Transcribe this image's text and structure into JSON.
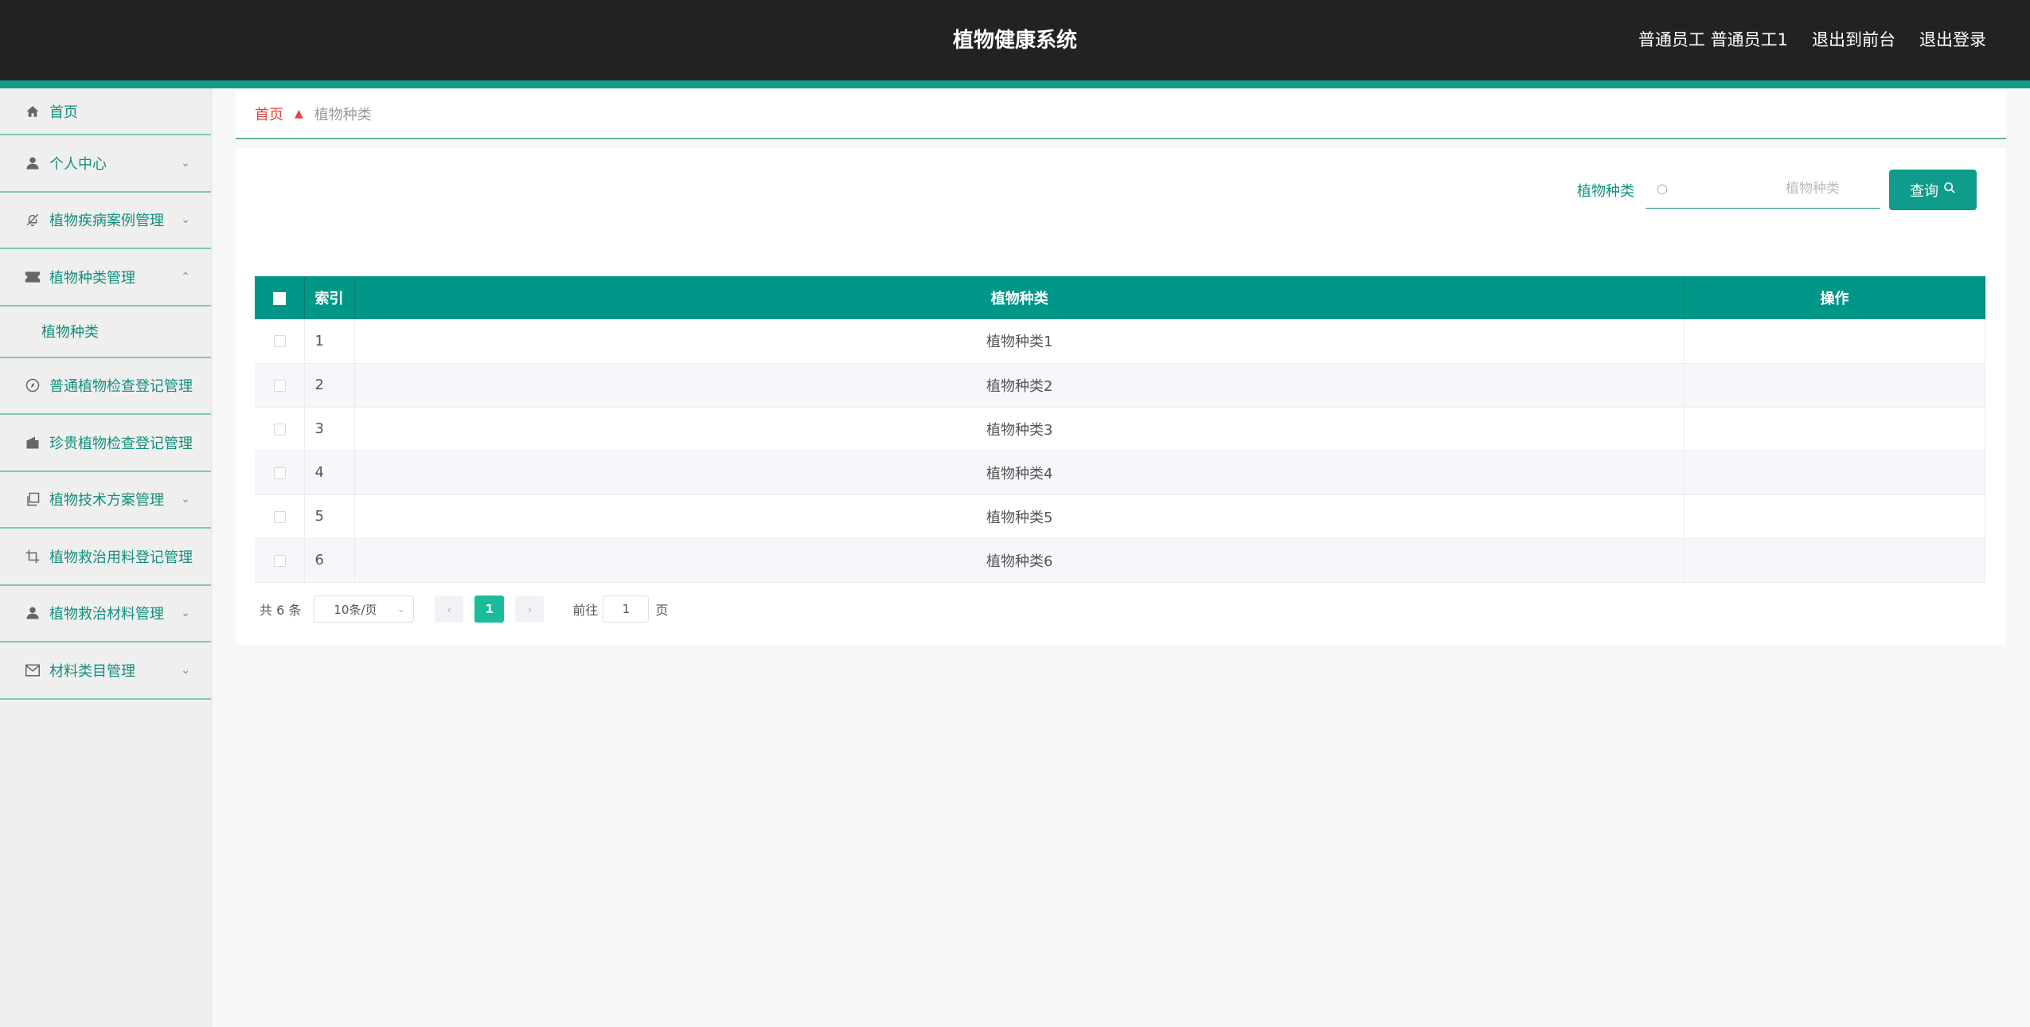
{
  "header": {
    "title": "植物健康系统",
    "user": "普通员工 普通员工1",
    "exit_front": "退出到前台",
    "logout": "退出登录"
  },
  "sidebar": {
    "items": [
      {
        "label": "首页",
        "icon": "home-icon"
      },
      {
        "label": "个人中心",
        "icon": "user-icon"
      },
      {
        "label": "植物疾病案例管理",
        "icon": "bell-off-icon"
      },
      {
        "label": "植物种类管理",
        "icon": "ticket-icon",
        "expanded": true,
        "sub": [
          {
            "label": "植物种类"
          }
        ]
      },
      {
        "label": "普通植物检查登记管理",
        "icon": "compass-icon"
      },
      {
        "label": "珍贵植物检查登记管理",
        "icon": "wallet-icon"
      },
      {
        "label": "植物技术方案管理",
        "icon": "copy-icon"
      },
      {
        "label": "植物救治用料登记管理",
        "icon": "crop-icon"
      },
      {
        "label": "植物救治材料管理",
        "icon": "user-icon"
      },
      {
        "label": "材料类目管理",
        "icon": "mail-icon"
      }
    ]
  },
  "breadcrumb": {
    "home": "首页",
    "current": "植物种类"
  },
  "search": {
    "label": "植物种类",
    "placeholder": "植物种类",
    "button": "查询"
  },
  "table": {
    "headers": [
      "索引",
      "植物种类",
      "操作"
    ],
    "rows": [
      {
        "index": "1",
        "name": "植物种类1"
      },
      {
        "index": "2",
        "name": "植物种类2"
      },
      {
        "index": "3",
        "name": "植物种类3"
      },
      {
        "index": "4",
        "name": "植物种类4"
      },
      {
        "index": "5",
        "name": "植物种类5"
      },
      {
        "index": "6",
        "name": "植物种类6"
      }
    ]
  },
  "pagination": {
    "total": "共 6 条",
    "page_size": "10条/页",
    "current_page": "1",
    "goto_label": "前往",
    "goto_value": "1",
    "page_suffix": "页"
  },
  "colors": {
    "accent": "#009688",
    "header_bg": "#222222",
    "breadcrumb_home": "#e0473c",
    "active_page": "#1abc9c"
  }
}
